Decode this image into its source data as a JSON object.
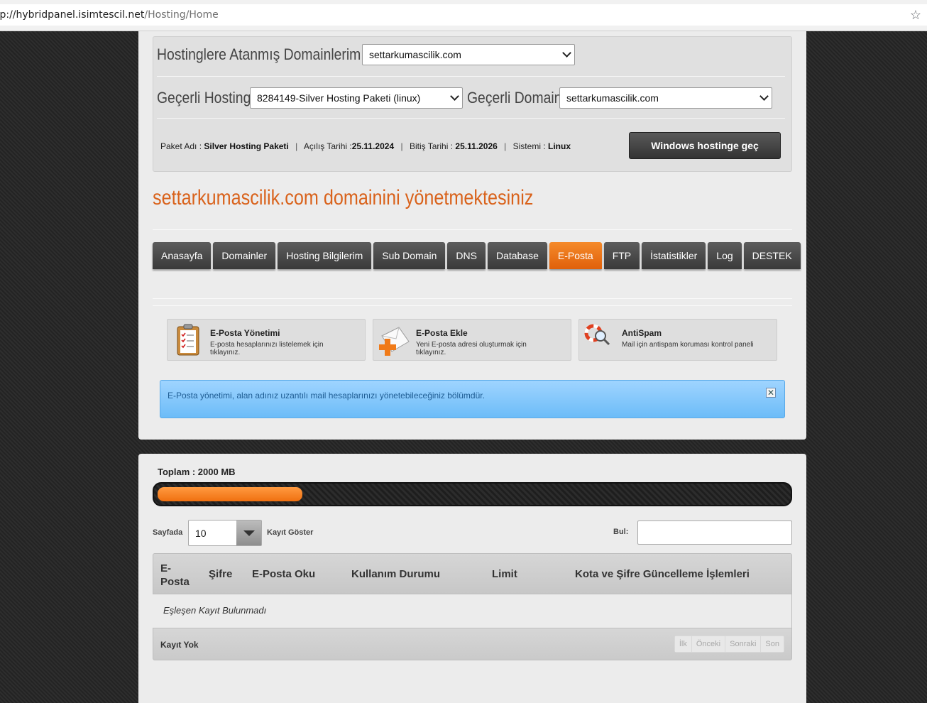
{
  "browser": {
    "url_host": "tp://hybridpanel.isimtescil.net",
    "url_path": "/Hosting/Home"
  },
  "header": {
    "assigned_domains_label": "Hostinglere Atanmış Domainlerim",
    "assigned_domain_value": "settarkumascilik.com",
    "current_hosting_label": "Geçerli Hosting",
    "current_hosting_value": "8284149-Silver Hosting Paketi (linux)",
    "current_domain_label": "Geçerli Domain",
    "current_domain_value": "settarkumascilik.com",
    "package_name_label": "Paket Adı :",
    "package_name_value": "Silver Hosting Paketi",
    "open_date_label": "Açılış Tarihi :",
    "open_date_value": "25.11.2024",
    "end_date_label": "Bitiş Tarihi :",
    "end_date_value": "25.11.2026",
    "system_label": "Sistemi :",
    "system_value": "Linux",
    "switch_button": "Windows hostinge geç"
  },
  "manage_title": "settarkumascilik.com domainini yönetmektesiniz",
  "tabs": [
    {
      "label": "Anasayfa",
      "active": false
    },
    {
      "label": "Domainler",
      "active": false
    },
    {
      "label": "Hosting Bilgilerim",
      "active": false
    },
    {
      "label": "Sub Domain",
      "active": false
    },
    {
      "label": "DNS",
      "active": false
    },
    {
      "label": "Database",
      "active": false
    },
    {
      "label": "E-Posta",
      "active": true
    },
    {
      "label": "FTP",
      "active": false
    },
    {
      "label": "İstatistikler",
      "active": false
    },
    {
      "label": "Log",
      "active": false
    },
    {
      "label": "DESTEK",
      "active": false
    }
  ],
  "quick_links": [
    {
      "title": "E-Posta Yönetimi",
      "desc": "E-posta hesaplarınızı listelemek için tıklayınız.",
      "icon": "clipboard-checklist-icon"
    },
    {
      "title": "E-Posta Ekle",
      "desc": "Yeni E-posta adresi oluşturmak için tıklayınız.",
      "icon": "add-mail-icon"
    },
    {
      "title": "AntiSpam",
      "desc": "Mail için antispam koruması kontrol paneli",
      "icon": "lifebuoy-search-icon"
    }
  ],
  "alert": {
    "text": "E-Posta yönetimi, alan adınız uzantılı mail hesaplarınızı yönetebileceğiniz bölümdür.",
    "close": "✕"
  },
  "quota": {
    "total_label": "Toplam : 2000 MB",
    "used_fraction": 0.23
  },
  "table": {
    "per_page_label": "Sayfada",
    "per_page_value": "10",
    "show_records_label": "Kayıt Göster",
    "search_label": "Bul:",
    "search_value": "",
    "columns": [
      "E-Posta",
      "Şifre",
      "E-Posta Oku",
      "Kullanım Durumu",
      "Limit",
      "Kota ve Şifre Güncelleme İşlemleri"
    ],
    "empty_message": "Eşleşen Kayıt Bulunmadı",
    "footer_info": "Kayıt Yok",
    "pager": [
      "İlk",
      "Önceki",
      "Sonraki",
      "Son"
    ]
  },
  "colors": {
    "accent": "#f07010",
    "title_orange": "#d9621b",
    "alert_blue": "#6cbcf8"
  }
}
